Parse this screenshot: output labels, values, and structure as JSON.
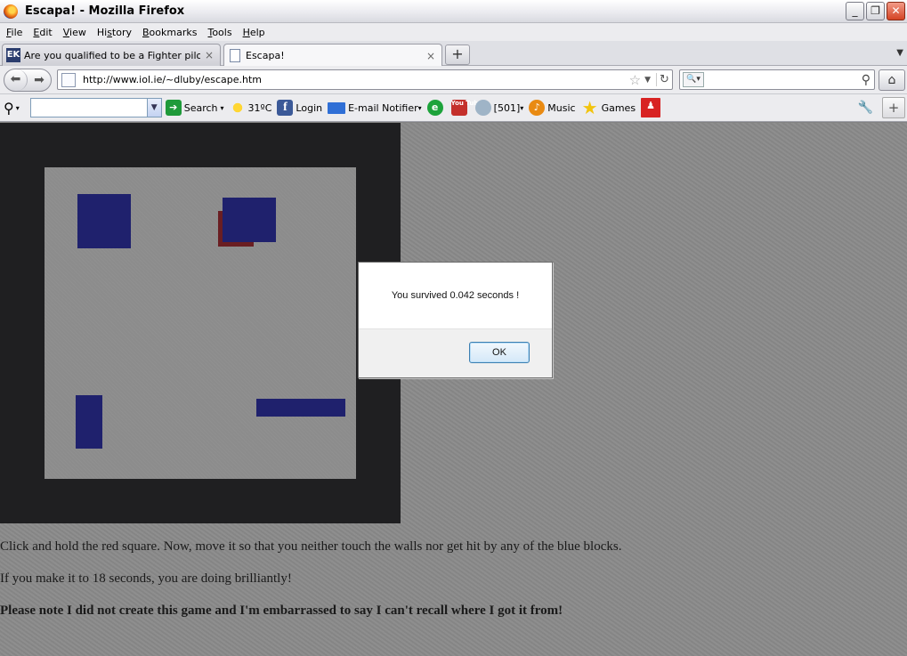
{
  "window": {
    "title": "Escapa! - Mozilla Firefox",
    "min": "_",
    "restore": "❐",
    "close": "✕"
  },
  "menu": [
    {
      "u": "F",
      "rest": "ile"
    },
    {
      "u": "E",
      "rest": "dit"
    },
    {
      "u": "V",
      "rest": "iew"
    },
    {
      "pre": "Hi",
      "u": "s",
      "rest": "tory"
    },
    {
      "u": "B",
      "rest": "ookmarks"
    },
    {
      "u": "T",
      "rest": "ools"
    },
    {
      "u": "H",
      "rest": "elp"
    }
  ],
  "tabs": [
    {
      "label": "Are you qualified to be a Fighter pilot? ta...",
      "close": "×",
      "favicon": "EK"
    },
    {
      "label": "Escapa!",
      "close": "×"
    }
  ],
  "newtab_label": "+",
  "nav": {
    "url": "http://www.iol.ie/~dluby/escape.htm",
    "star": "☆",
    "reload": "↻",
    "home": "⌂",
    "search_value": ""
  },
  "toolbar": {
    "search_label": "Search",
    "weather": "31ºC",
    "login": "Login",
    "email": "E-mail Notifier",
    "counter": "[501]",
    "music": "Music",
    "games": "Games"
  },
  "page": {
    "instruction_1": "Click and hold the red square. Now, move it so that you neither touch the walls nor get hit by any of the blue blocks.",
    "instruction_2": "If you make it to 18 seconds, you are doing brilliantly!",
    "note": "Please note I did not create this game and I'm embarrassed to say I can't recall where I got it from!"
  },
  "dialog": {
    "message": "You survived 0.042 seconds !",
    "ok_label": "OK"
  },
  "colors": {
    "wall": "#1f1f21",
    "field": "#8c8c8c",
    "blue_block": "#1f216d",
    "red_square": "#6a1e22"
  }
}
